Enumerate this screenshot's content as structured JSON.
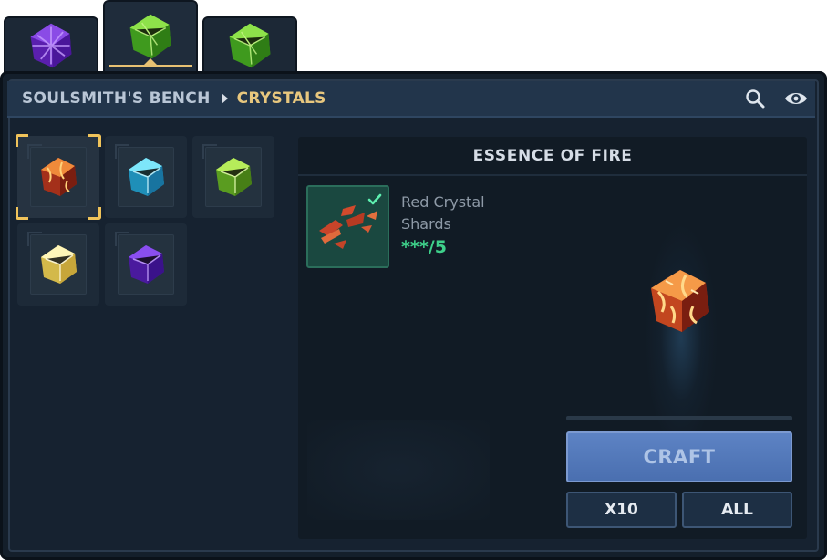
{
  "category_tabs": [
    {
      "icon": "purple-crystal-icon",
      "color": "#7a3bd6",
      "active": false
    },
    {
      "icon": "green-crystal-icon",
      "color": "#5fc932",
      "active": true
    },
    {
      "icon": "green-crystal-icon",
      "color": "#5fc932",
      "active": false
    }
  ],
  "header": {
    "breadcrumb_root": "SOULSMITH'S BENCH",
    "breadcrumb_current": "CRYSTALS",
    "icons": [
      "search-icon",
      "eye-icon"
    ]
  },
  "crystals": [
    {
      "icon": "fire-crystal-icon",
      "color": "#e0632a",
      "selected": true
    },
    {
      "icon": "cyan-crystal-icon",
      "color": "#43c8e8",
      "selected": false
    },
    {
      "icon": "lime-crystal-icon",
      "color": "#8fd33a",
      "selected": false
    },
    {
      "icon": "yellow-crystal-icon",
      "color": "#f3e07a",
      "selected": false
    },
    {
      "icon": "purple-crystal-icon",
      "color": "#6c2fd0",
      "selected": false
    }
  ],
  "detail": {
    "title": "ESSENCE OF FIRE",
    "ingredient": {
      "icon": "red-crystal-shards-icon",
      "name_line1": "Red Crystal",
      "name_line2": "Shards",
      "count": "***/5",
      "fulfilled": true
    },
    "result_icon": "fire-crystal-icon",
    "progress": 0
  },
  "buttons": {
    "craft": "CRAFT",
    "x10": "X10",
    "all": "ALL"
  },
  "colors": {
    "accent_gold": "#e8c77e",
    "count_green": "#3ed08a",
    "craft_blue": "#5a7fc0"
  }
}
